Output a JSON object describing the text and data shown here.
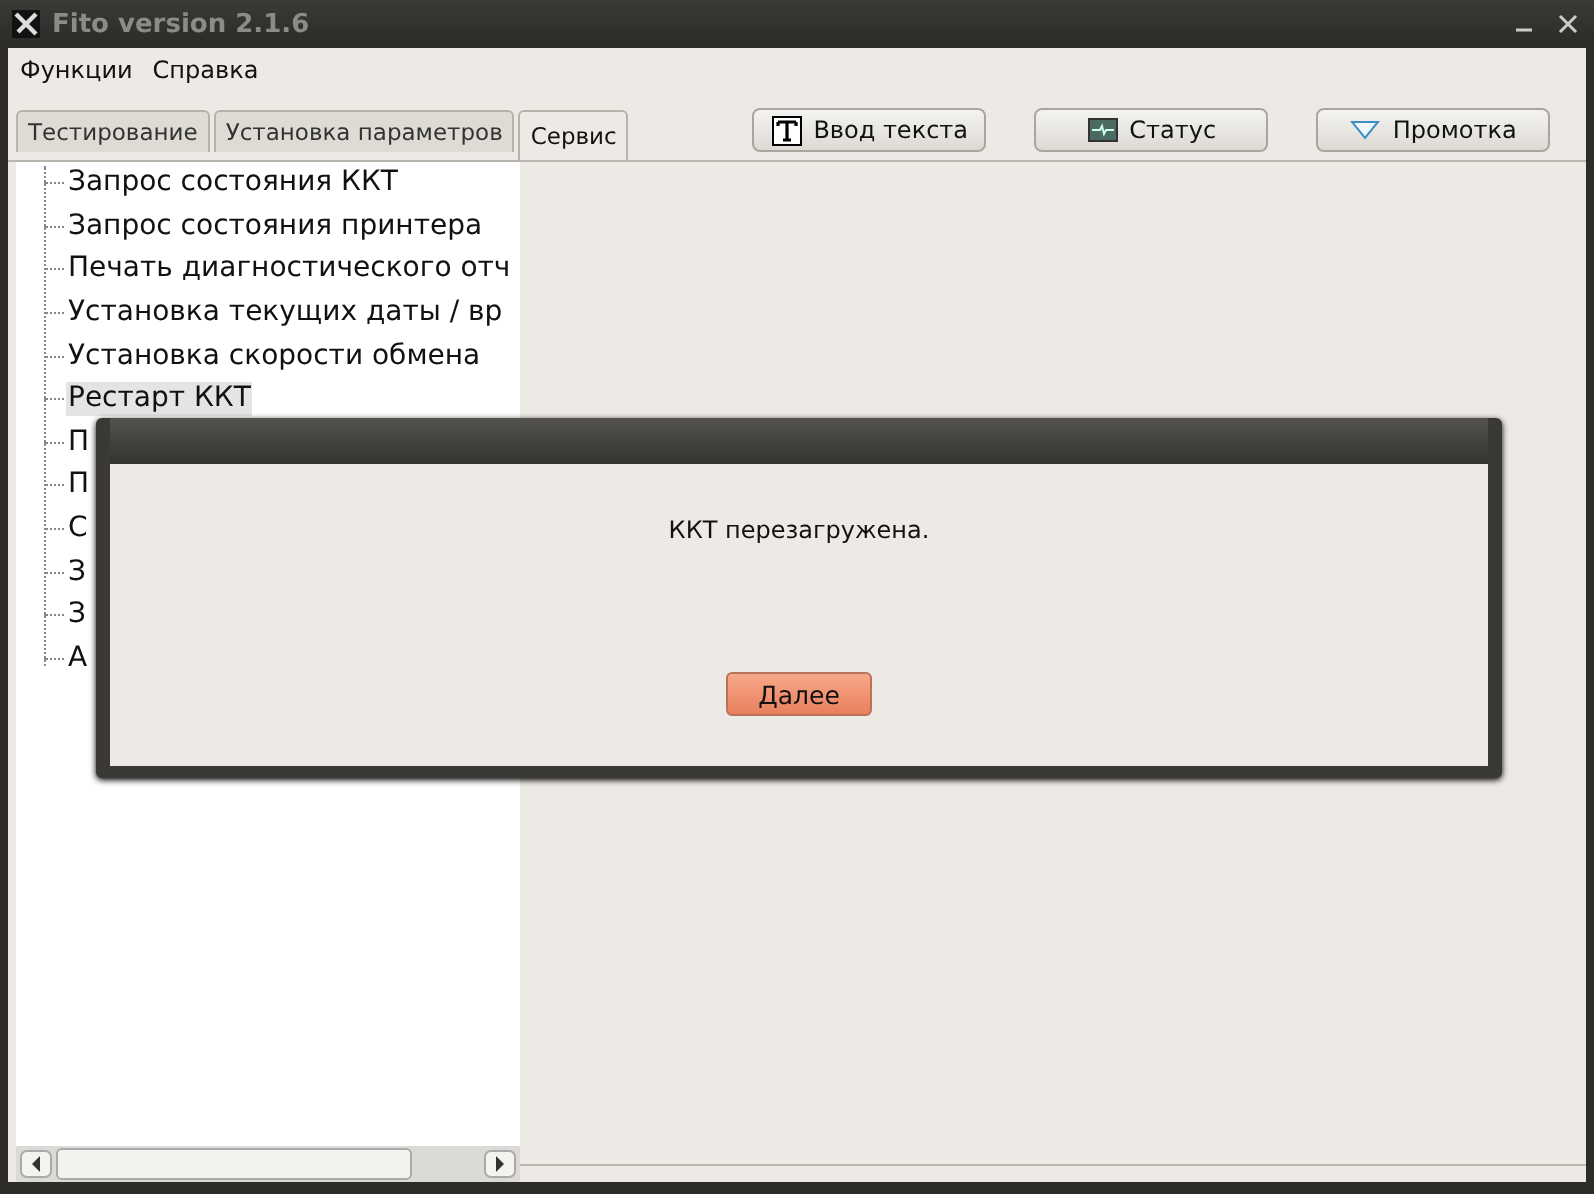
{
  "window": {
    "title": "Fito version 2.1.6"
  },
  "menu": [
    "Функции",
    "Справка"
  ],
  "tabs": [
    {
      "label": "Тестирование",
      "selected": false
    },
    {
      "label": "Установка параметров",
      "selected": false
    },
    {
      "label": "Сервис",
      "selected": true
    }
  ],
  "toolbar": [
    {
      "label": "Ввод текста",
      "kind": "text"
    },
    {
      "label": "Статус",
      "kind": "status"
    },
    {
      "label": "Промотка",
      "kind": "feed"
    }
  ],
  "tree": {
    "items": [
      {
        "label": "Запрос состояния ККТ",
        "selected": false
      },
      {
        "label": "Запрос состояния принтера",
        "selected": false
      },
      {
        "label": "Печать диагностического отч",
        "selected": false
      },
      {
        "label": "Установка текущих даты / вр",
        "selected": false
      },
      {
        "label": "Установка скорости обмена",
        "selected": false
      },
      {
        "label": "Рестарт ККТ",
        "selected": true
      },
      {
        "label": "П",
        "selected": false
      },
      {
        "label": "П",
        "selected": false
      },
      {
        "label": "С",
        "selected": false
      },
      {
        "label": "З",
        "selected": false
      },
      {
        "label": "З",
        "selected": false
      },
      {
        "label": "А",
        "selected": false
      }
    ]
  },
  "dialog": {
    "message": "ККТ перезагружена.",
    "button": "Далее"
  }
}
